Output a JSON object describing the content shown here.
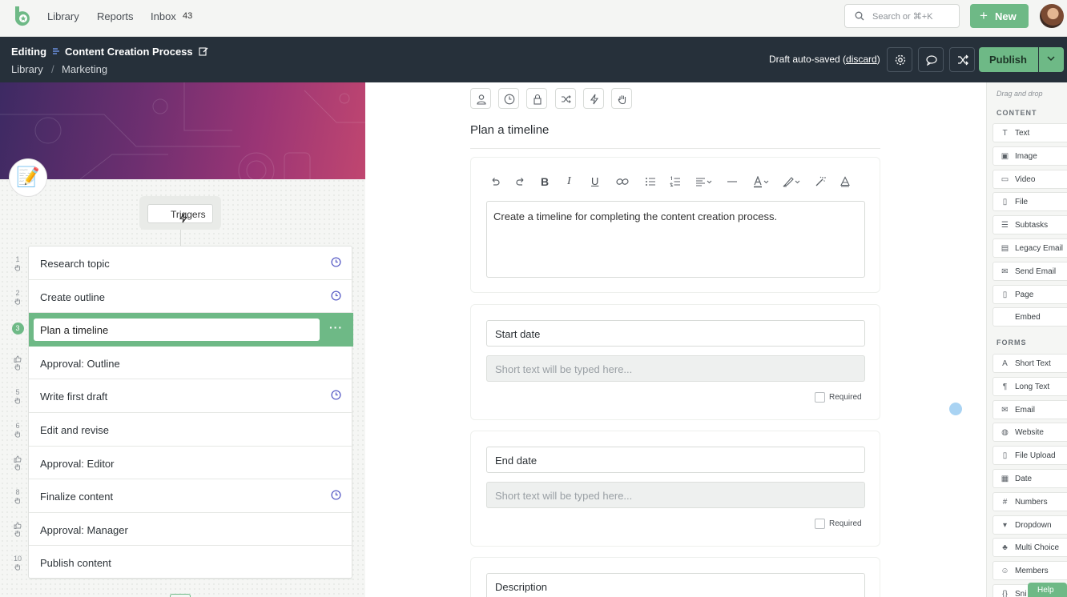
{
  "topnav": {
    "links": [
      "Library",
      "Reports",
      "Inbox"
    ],
    "inbox_count": "43",
    "search_placeholder": "Search or ⌘+K",
    "new_label": "New"
  },
  "header": {
    "editing_label": "Editing",
    "workflow_title": "Content Creation Process",
    "breadcrumb": [
      "Library",
      "Marketing"
    ],
    "breadcrumb_sep": "/",
    "draft_text": "Draft auto-saved (",
    "discard_label": "discard",
    "draft_close": ")",
    "publish_label": "Publish"
  },
  "left": {
    "emoji": "📝",
    "triggers_label": "Triggers",
    "active_index": 2,
    "steps": [
      {
        "num": "1",
        "label": "Research topic",
        "kind": "task",
        "due": true
      },
      {
        "num": "2",
        "label": "Create outline",
        "kind": "task",
        "due": true
      },
      {
        "num": "3",
        "label": "Plan a timeline",
        "kind": "task",
        "due": false
      },
      {
        "num": "",
        "label": "Approval: Outline",
        "kind": "approval",
        "due": false
      },
      {
        "num": "5",
        "label": "Write first draft",
        "kind": "task",
        "due": true
      },
      {
        "num": "6",
        "label": "Edit and revise",
        "kind": "task",
        "due": false
      },
      {
        "num": "",
        "label": "Approval: Editor",
        "kind": "approval",
        "due": false
      },
      {
        "num": "8",
        "label": "Finalize content",
        "kind": "task",
        "due": true
      },
      {
        "num": "",
        "label": "Approval: Manager",
        "kind": "approval",
        "due": false
      },
      {
        "num": "10",
        "label": "Publish content",
        "kind": "task",
        "due": false
      }
    ]
  },
  "center": {
    "step_title": "Plan a timeline",
    "text_content": "Create a timeline for completing the content creation process.",
    "fields": [
      {
        "label": "Start date",
        "placeholder": "Short text will be typed here...",
        "required_label": "Required"
      },
      {
        "label": "End date",
        "placeholder": "Short text will be typed here...",
        "required_label": "Required"
      },
      {
        "label": "Description"
      }
    ]
  },
  "sidebar": {
    "hint": "Drag and drop",
    "content_title": "CONTENT",
    "content_items": [
      {
        "label": "Text",
        "icon": "text-icon"
      },
      {
        "label": "Image",
        "icon": "image-icon"
      },
      {
        "label": "Video",
        "icon": "video-icon"
      },
      {
        "label": "File",
        "icon": "file-icon"
      },
      {
        "label": "Subtasks",
        "icon": "subtasks-icon"
      },
      {
        "label": "Legacy Email",
        "icon": "legacy-email-icon"
      },
      {
        "label": "Send Email",
        "icon": "mail-icon"
      },
      {
        "label": "Page",
        "icon": "page-icon"
      },
      {
        "label": "Embed",
        "icon": "code-icon"
      }
    ],
    "forms_title": "FORMS",
    "forms_items": [
      {
        "label": "Short Text",
        "icon": "letter-a-icon"
      },
      {
        "label": "Long Text",
        "icon": "paragraph-icon"
      },
      {
        "label": "Email",
        "icon": "mail-icon"
      },
      {
        "label": "Website",
        "icon": "globe-icon"
      },
      {
        "label": "File Upload",
        "icon": "file-icon"
      },
      {
        "label": "Date",
        "icon": "calendar-icon"
      },
      {
        "label": "Numbers",
        "icon": "hash-icon"
      },
      {
        "label": "Dropdown",
        "icon": "dropdown-icon"
      },
      {
        "label": "Multi Choice",
        "icon": "multi-choice-icon"
      },
      {
        "label": "Members",
        "icon": "members-icon"
      },
      {
        "label": "Sni",
        "icon": "braces-icon"
      }
    ],
    "help_label": "Help"
  },
  "colors": {
    "accent": "#6eb986",
    "header": "#26303a",
    "clock": "#5b5fc7"
  }
}
